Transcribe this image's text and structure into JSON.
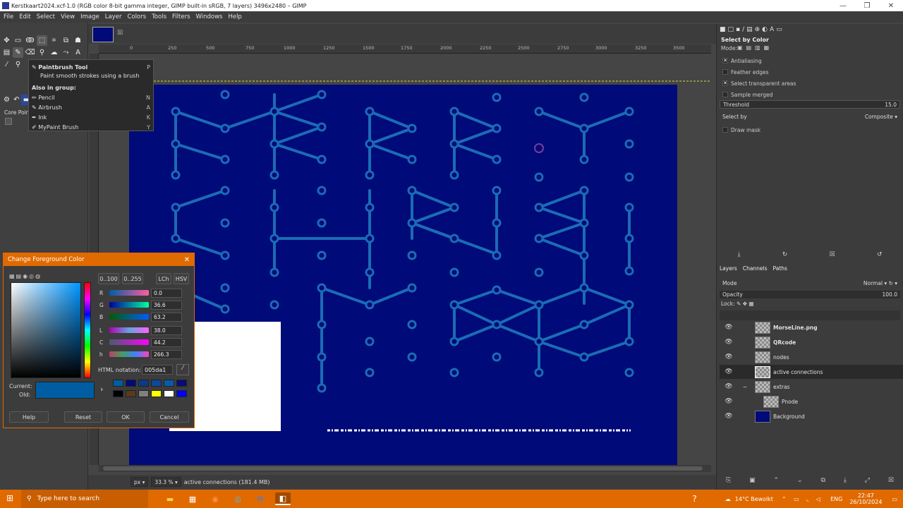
{
  "window": {
    "title": "Kerstkaart2024.xcf-1.0 (RGB color 8-bit gamma integer, GIMP built-in sRGB, 7 layers) 3496x2480 – GIMP",
    "min": "—",
    "max": "❐",
    "close": "✕"
  },
  "menu": [
    "File",
    "Edit",
    "Select",
    "View",
    "Image",
    "Layer",
    "Colors",
    "Tools",
    "Filters",
    "Windows",
    "Help"
  ],
  "ruler": {
    "h_ticks": [
      "0",
      "250",
      "500",
      "750",
      "1000",
      "1250",
      "1500",
      "1750",
      "2000",
      "2250",
      "2500",
      "2750",
      "3000",
      "3250",
      "3500"
    ],
    "v_ticks": [
      "0",
      "250",
      "500",
      "750",
      "1000",
      "1250",
      "1500",
      "1750",
      "2000",
      "2250"
    ]
  },
  "tooltip": {
    "title": "Paintbrush Tool",
    "title_key": "P",
    "desc": "Paint smooth strokes using a brush",
    "group_label": "Also in group:",
    "items": [
      {
        "label": "Pencil",
        "key": "N"
      },
      {
        "label": "Airbrush",
        "key": "A"
      },
      {
        "label": "Ink",
        "key": "K"
      },
      {
        "label": "MyPaint Brush",
        "key": "Y"
      }
    ]
  },
  "core_points_label": "Core Poin",
  "fg_dialog": {
    "title": "Change Foreground Color",
    "range_0_100": "0..100",
    "range_0_255": "0..255",
    "lch": "LCh",
    "hsv": "HSV",
    "channels": [
      {
        "label": "R",
        "value": "0.0"
      },
      {
        "label": "G",
        "value": "36.6"
      },
      {
        "label": "B",
        "value": "63.2"
      },
      {
        "label": "L",
        "value": "38.0"
      },
      {
        "label": "C",
        "value": "44.2"
      },
      {
        "label": "h",
        "value": "266.3"
      }
    ],
    "html_notation_label": "HTML notation:",
    "html_notation_value": "005da1",
    "current_label": "Current:",
    "old_label": "Old:",
    "current_color": "#005da1",
    "buttons": {
      "help": "Help",
      "reset": "Reset",
      "ok": "OK",
      "cancel": "Cancel"
    },
    "history_colors": [
      "#005da1",
      "#000a78",
      "#0a3a8a",
      "#0a4a9a",
      "#0a5aaa",
      "#0a0a78",
      "#000000",
      "#5a3a1a",
      "#808080",
      "#ffff00",
      "#ffffff",
      "#0000ff"
    ]
  },
  "tool_options": {
    "title": "Select by Color",
    "mode_label": "Mode:",
    "antialiasing": "Antialiasing",
    "feather": "Feather edges",
    "select_transparent": "Select transparent areas",
    "sample_merged": "Sample merged",
    "threshold_label": "Threshold",
    "threshold_value": "15.0",
    "select_by_label": "Select by",
    "select_by_value": "Composite",
    "draw_mask": "Draw mask"
  },
  "layers_panel": {
    "tabs": [
      "Layers",
      "Channels",
      "Paths"
    ],
    "mode_label": "Mode",
    "mode_value": "Normal",
    "opacity_label": "Opacity",
    "opacity_value": "100.0",
    "lock_label": "Lock:",
    "layers": [
      {
        "name": "MorseLine.png",
        "bold": true,
        "active": false,
        "indent": 0
      },
      {
        "name": "QRcode",
        "bold": true,
        "active": false,
        "indent": 0
      },
      {
        "name": "nodes",
        "bold": false,
        "active": false,
        "indent": 0
      },
      {
        "name": "active connections",
        "bold": false,
        "active": true,
        "indent": 0
      },
      {
        "name": "extras",
        "bold": false,
        "active": false,
        "indent": 0
      },
      {
        "name": "Pnode",
        "bold": false,
        "active": false,
        "indent": 1
      },
      {
        "name": "Background",
        "bold": false,
        "active": false,
        "indent": 0,
        "bg": "#000a78"
      }
    ]
  },
  "status": {
    "unit": "px",
    "zoom": "33.3 %",
    "text": "active connections (181.4 MB)"
  },
  "taskbar": {
    "search_placeholder": "Type here to search",
    "weather": "14°C  Bewolkt",
    "lang": "ENG",
    "time": "22:47",
    "date": "26/10/2024"
  },
  "colors": {
    "canvas_bg": "#000a78",
    "line": "#1a6cb5",
    "accent": "#e06a00"
  }
}
